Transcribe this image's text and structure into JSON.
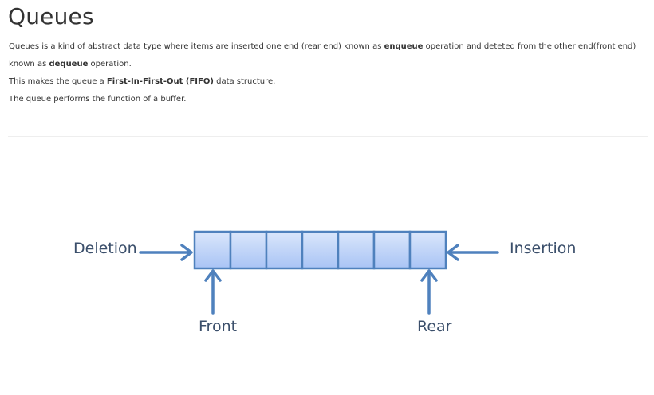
{
  "page": {
    "title": "Queues",
    "para1": {
      "text1": "Queues is a kind of abstract data type where items are inserted one end (rear end) known as ",
      "bold1": "enqueue",
      "text2": " operation and deteted from the other end(front end) known as ",
      "bold2": "dequeue",
      "text3": " operation."
    },
    "para2": {
      "text1": "This makes the queue a ",
      "bold1": "First-In-First-Out (FIFO)",
      "text2": " data structure."
    },
    "para3": "The queue performs the function of a buffer."
  },
  "diagram": {
    "labels": {
      "deletion": "Deletion",
      "insertion": "Insertion",
      "front": "Front",
      "rear": "Rear"
    },
    "cell_count": 7,
    "colors": {
      "arrow": "#4f81bd",
      "cell_border": "#4f81bd",
      "cell_fill_top": "#dae6fb",
      "cell_fill_bottom": "#a9c4f5",
      "label": "#3b4f6b"
    }
  }
}
